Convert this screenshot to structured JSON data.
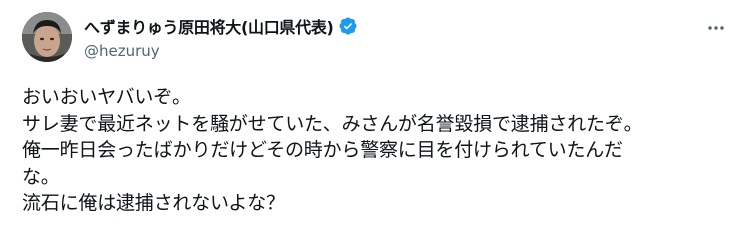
{
  "user": {
    "display_name": "へずまりゅう原田将大(山口県代表)",
    "handle": "@hezuruy",
    "verified_icon": "verified-badge-icon",
    "avatar": "avatar"
  },
  "menu": {
    "icon": "more-options-icon"
  },
  "tweet": {
    "lines": [
      "おいおいヤバいぞ。",
      "サレ妻で最近ネットを騒がせていた、みさんが名誉毀損で逮捕されたぞ。",
      "俺一昨日会ったばかりだけどその時から警察に目を付けられていたんだ",
      "な。",
      "流石に俺は逮捕されないよな？"
    ]
  },
  "colors": {
    "text": "#0f1419",
    "secondary": "#536471",
    "verified": "#1d9bf0"
  }
}
